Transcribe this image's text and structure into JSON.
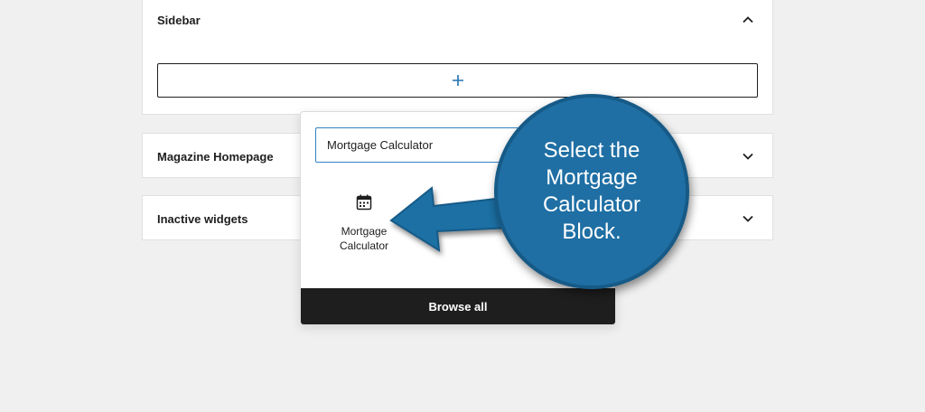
{
  "widget_areas": {
    "sidebar": {
      "title": "Sidebar",
      "state": "expanded",
      "add_block_icon": "plus-icon"
    },
    "magazine_homepage": {
      "title": "Magazine Homepage",
      "state": "collapsed"
    },
    "inactive_widgets": {
      "title": "Inactive widgets",
      "state": "collapsed"
    }
  },
  "inserter": {
    "search_value": "Mortgage Calculator",
    "results": [
      {
        "label": "Mortgage Calculator",
        "icon": "calendar-icon"
      }
    ],
    "browse_all_label": "Browse all"
  },
  "callout": {
    "text": "Select the Mortgage Calculator Block.",
    "color": "#1f6fa4"
  },
  "colors": {
    "accent": "#3582c4",
    "dark": "#1e1e1e",
    "background": "#f0f0f0"
  }
}
